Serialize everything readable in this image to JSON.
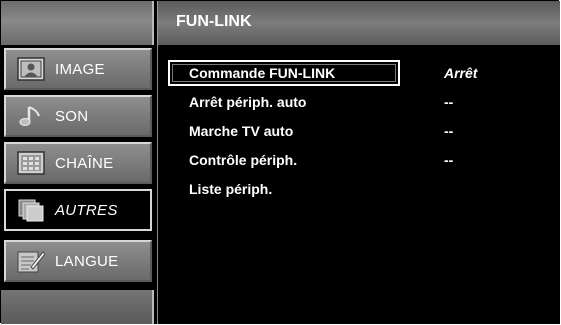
{
  "header": {
    "title": "FUN-LINK"
  },
  "sidebar": {
    "items": [
      {
        "label": "IMAGE",
        "icon": "picture-icon"
      },
      {
        "label": "SON",
        "icon": "music-note-icon"
      },
      {
        "label": "CHAÎNE",
        "icon": "channel-grid-icon"
      },
      {
        "label": "AUTRES",
        "icon": "stacked-pages-icon",
        "selected": true
      },
      {
        "label": "LANGUE",
        "icon": "language-document-icon"
      }
    ]
  },
  "options": [
    {
      "label": "Commande FUN-LINK",
      "value": "Arrêt",
      "focused": true
    },
    {
      "label": "Arrêt périph. auto",
      "value": "--"
    },
    {
      "label": "Marche TV auto",
      "value": "--"
    },
    {
      "label": "Contrôle périph.",
      "value": "--"
    },
    {
      "label": "Liste périph.",
      "value": ""
    }
  ],
  "colors": {
    "background": "#000000",
    "text": "#ffffff",
    "panel_gray": "#7a7a7a"
  }
}
